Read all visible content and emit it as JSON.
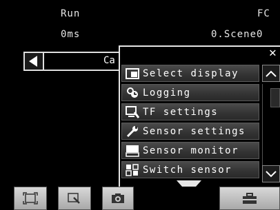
{
  "status": {
    "run_label": "Run",
    "fc_label": "FC",
    "time_label": "0ms",
    "scene_label": "0.Scene0"
  },
  "header": {
    "category_label": "Ca"
  },
  "menu": {
    "items": [
      {
        "label": "Select display",
        "icon": "display-select-icon"
      },
      {
        "label": "Logging",
        "icon": "logging-icon"
      },
      {
        "label": "TF settings",
        "icon": "tf-settings-icon"
      },
      {
        "label": "Sensor settings",
        "icon": "wrench-icon"
      },
      {
        "label": "Sensor monitor",
        "icon": "monitor-icon"
      },
      {
        "label": "Switch sensor",
        "icon": "switch-sensor-icon"
      }
    ]
  },
  "toolbar": {
    "buttons": [
      "fit-screen-icon",
      "zoom-area-icon",
      "camera-icon",
      "tools-icon"
    ]
  },
  "colors": {
    "background": "#000000",
    "menu_item": "#3a3a3a",
    "toolbar_button": "#c4c4c4"
  }
}
